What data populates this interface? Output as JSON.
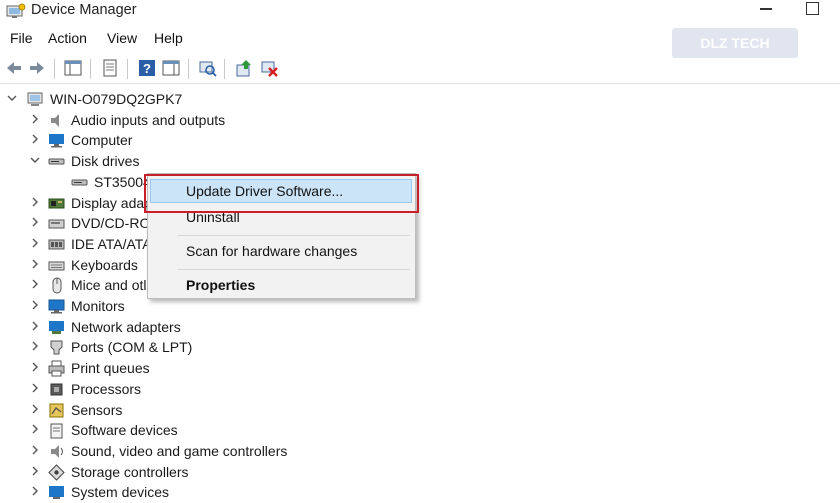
{
  "window": {
    "title": "Device Manager"
  },
  "menu": [
    "File",
    "Action",
    "View",
    "Help"
  ],
  "watermark_text": "DLZ TECH",
  "tree": {
    "root": "WIN-O079DQ2GPK7",
    "items": [
      {
        "label": "Audio inputs and outputs",
        "icon": "speaker-icon",
        "expanded": false
      },
      {
        "label": "Computer",
        "icon": "computer-icon",
        "expanded": false
      },
      {
        "label": "Disk drives",
        "icon": "disk-drive-icon",
        "expanded": true
      },
      {
        "label": "ST35004",
        "icon": "disk-drive-icon",
        "child": true,
        "selected": true
      },
      {
        "label": "Display adap",
        "icon": "display-adapter-icon",
        "expanded": false
      },
      {
        "label": "DVD/CD-RO",
        "icon": "dvd-drive-icon",
        "expanded": false
      },
      {
        "label": "IDE ATA/ATA",
        "icon": "ide-controller-icon",
        "expanded": false
      },
      {
        "label": "Keyboards",
        "icon": "keyboard-icon",
        "expanded": false
      },
      {
        "label": "Mice and otl",
        "icon": "mouse-icon",
        "expanded": false
      },
      {
        "label": "Monitors",
        "icon": "monitor-icon",
        "expanded": false
      },
      {
        "label": "Network adapters",
        "icon": "network-adapter-icon",
        "expanded": false
      },
      {
        "label": "Ports (COM & LPT)",
        "icon": "port-icon",
        "expanded": false
      },
      {
        "label": "Print queues",
        "icon": "printer-icon",
        "expanded": false
      },
      {
        "label": "Processors",
        "icon": "processor-icon",
        "expanded": false
      },
      {
        "label": "Sensors",
        "icon": "sensor-icon",
        "expanded": false
      },
      {
        "label": "Software devices",
        "icon": "software-device-icon",
        "expanded": false
      },
      {
        "label": "Sound, video and game controllers",
        "icon": "sound-controller-icon",
        "expanded": false
      },
      {
        "label": "Storage controllers",
        "icon": "storage-controller-icon",
        "expanded": false
      },
      {
        "label": "System devices",
        "icon": "system-device-icon",
        "expanded": false
      }
    ]
  },
  "context_menu": {
    "update": "Update Driver Software...",
    "uninstall": "Uninstall",
    "scan": "Scan for hardware changes",
    "properties": "Properties"
  },
  "colors": {
    "highlight": "#cce4f7",
    "highlight_border": "#99c9ef",
    "annotation_red": "#c8202a",
    "icon_blue": "#1e76c8"
  }
}
